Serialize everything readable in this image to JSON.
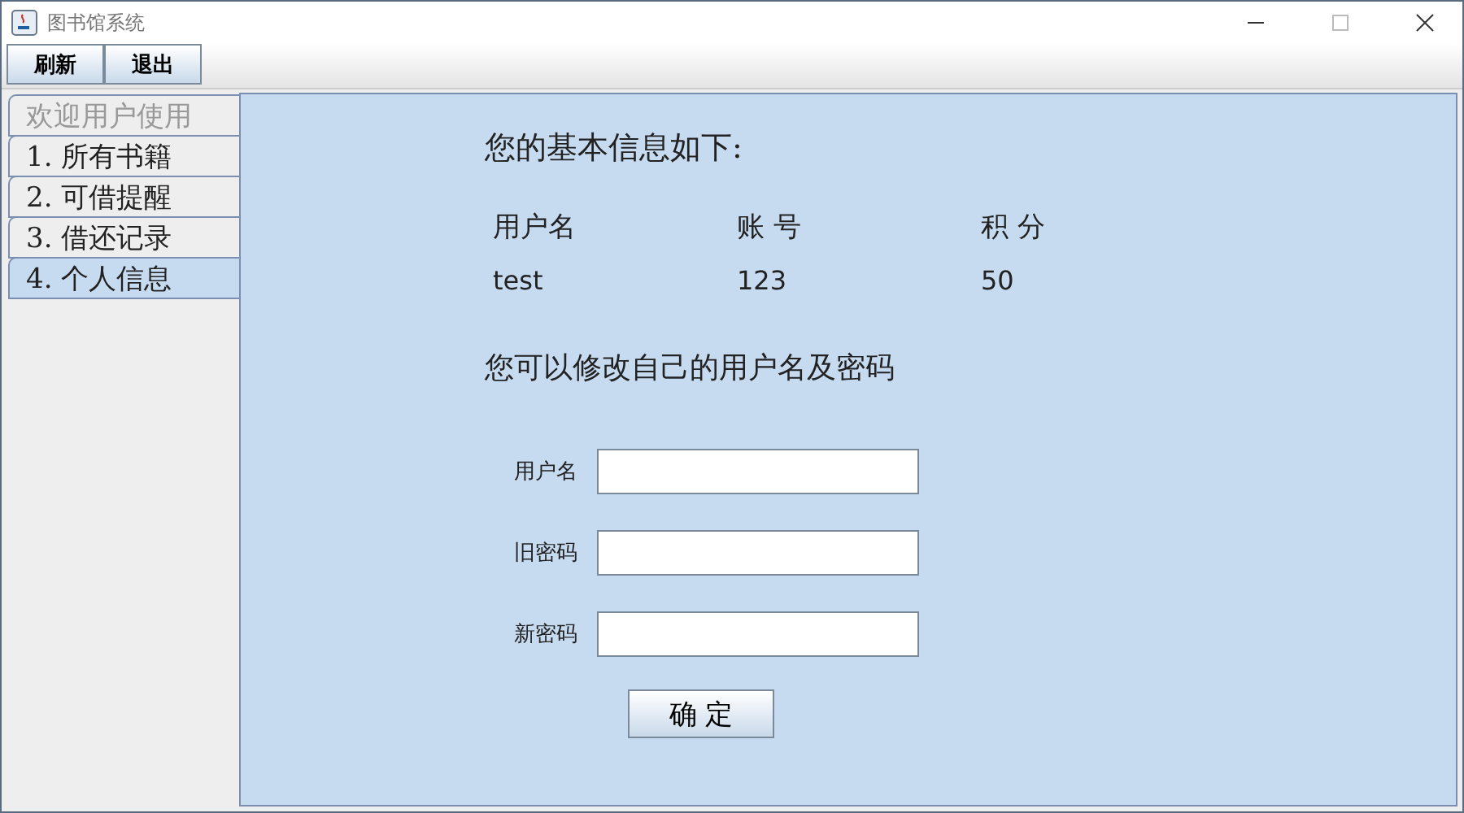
{
  "window": {
    "title": "图书馆系统"
  },
  "toolbar": [
    "刷新",
    "退出"
  ],
  "tabs": [
    {
      "label": "欢迎用户使用",
      "selected": false,
      "disabled": true
    },
    {
      "label": "1. 所有书籍",
      "selected": false,
      "disabled": false
    },
    {
      "label": "2. 可借提醒",
      "selected": false,
      "disabled": false
    },
    {
      "label": "3. 借还记录",
      "selected": false,
      "disabled": false
    },
    {
      "label": "4. 个人信息",
      "selected": true,
      "disabled": false
    }
  ],
  "info": {
    "heading": "您的基本信息如下:",
    "columns": [
      "用户名",
      "账 号",
      "积 分"
    ],
    "values": [
      "test",
      "123",
      "50"
    ]
  },
  "edit": {
    "heading": "您可以修改自己的用户名及密码",
    "fields": [
      {
        "label": "用户名"
      },
      {
        "label": "旧密码"
      },
      {
        "label": "新密码"
      }
    ],
    "submit": "确 定"
  }
}
